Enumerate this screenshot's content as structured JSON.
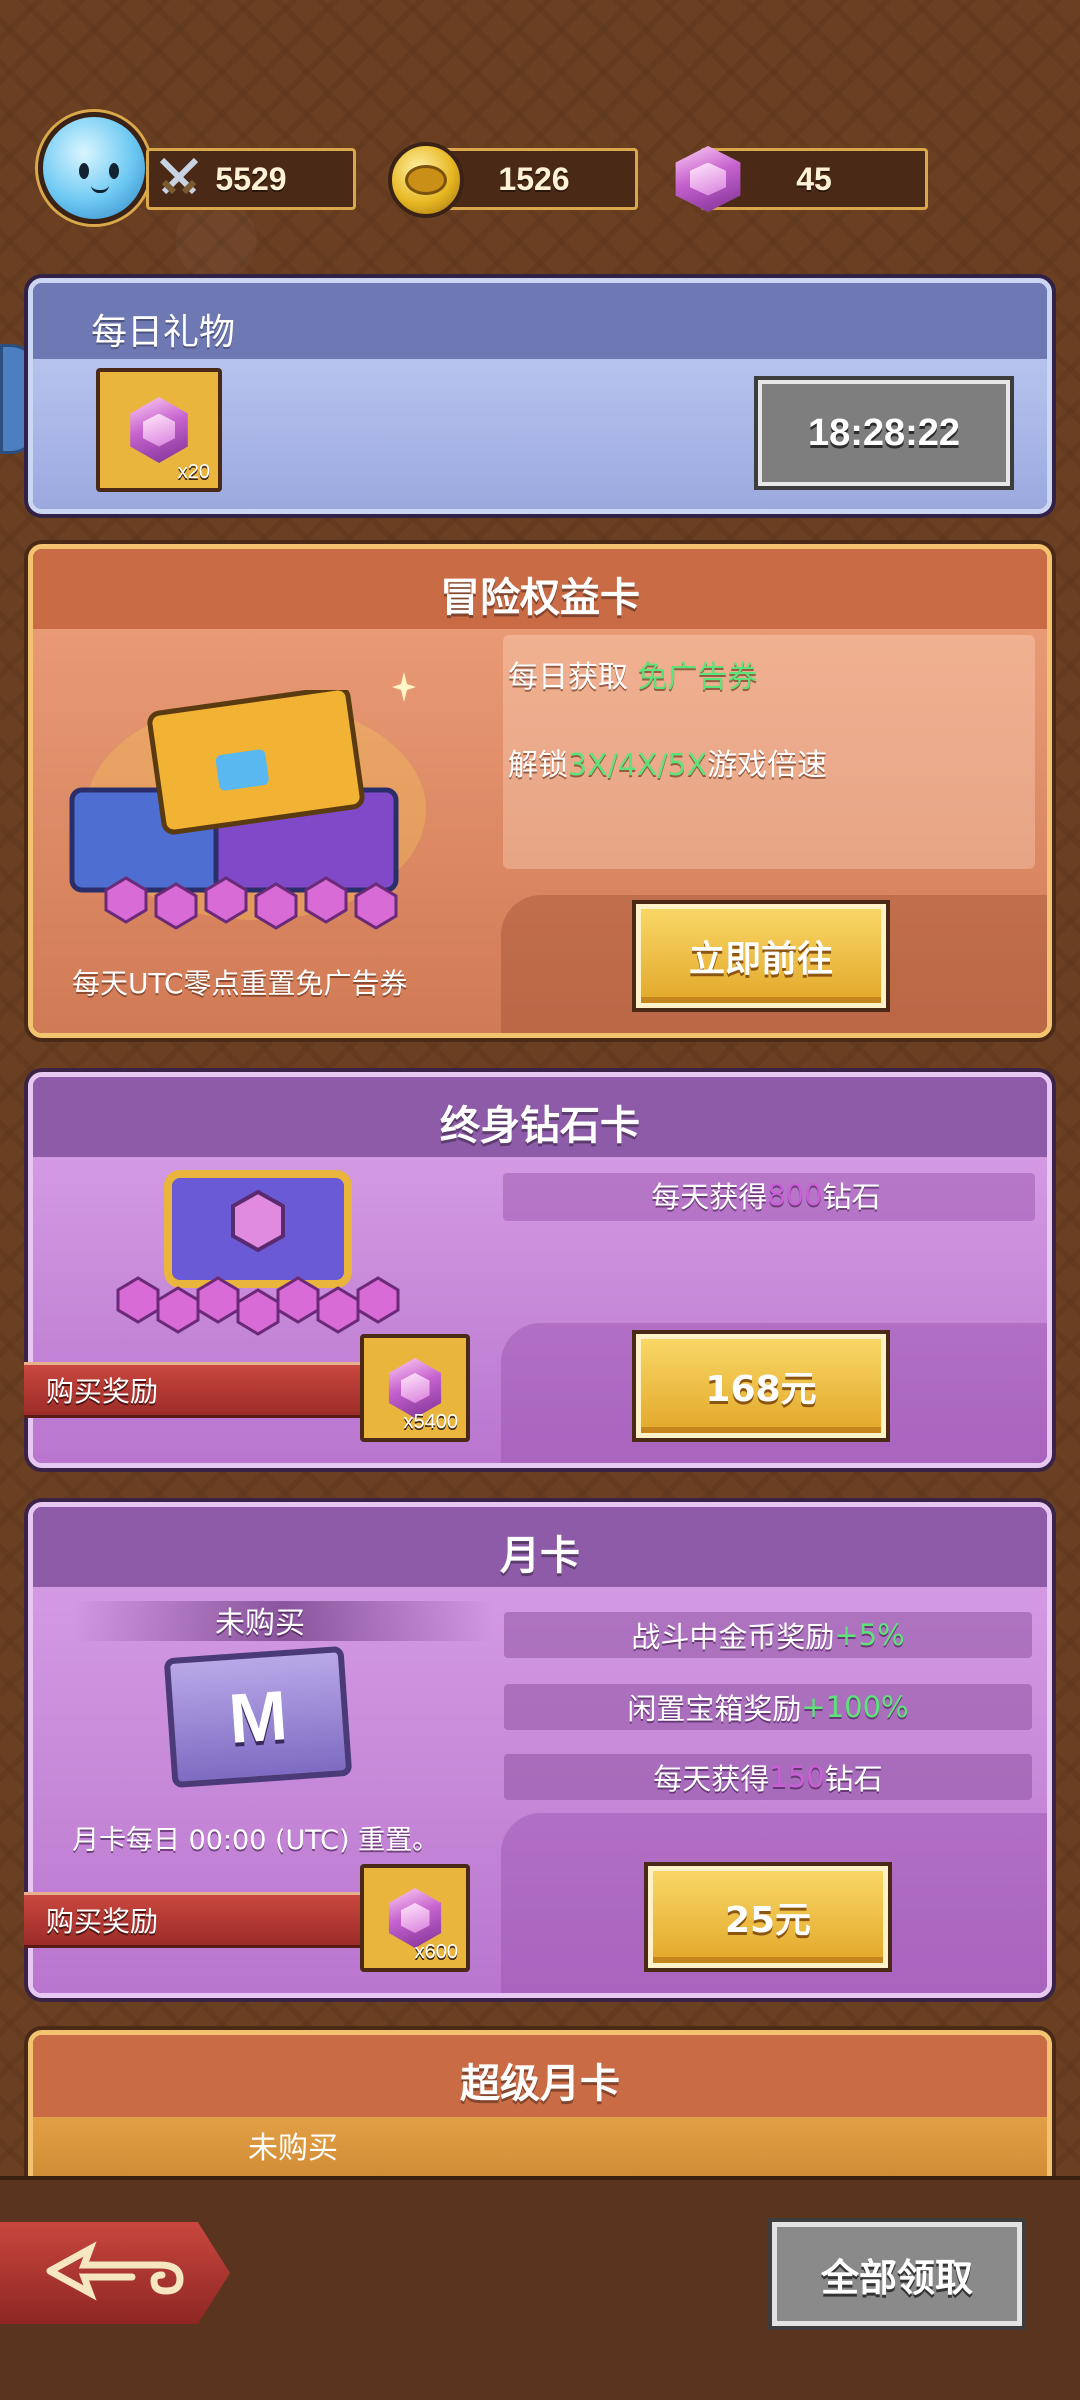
{
  "resources": {
    "power": "5529",
    "coins": "1526",
    "gems": "45"
  },
  "daily_gift": {
    "title": "每日礼物",
    "reward_qty": "x20",
    "timer": "18:28:22"
  },
  "adventure_card": {
    "title": "冒险权益卡",
    "benefit1_prefix": "每日获取 ",
    "benefit1_highlight": "免广告券",
    "benefit2_prefix": "解锁",
    "benefit2_highlight": "3X/4X/5X",
    "benefit2_suffix": "游戏倍速",
    "reset_note": "每天UTC零点重置免广告券",
    "button": "立即前往"
  },
  "lifetime_card": {
    "title": "终身钻石卡",
    "benefit_prefix": "每天获得 ",
    "benefit_value": "800",
    "benefit_suffix": " 钻石",
    "ribbon": "购买奖励",
    "reward_qty": "x5400",
    "price": "168元"
  },
  "monthly_card": {
    "title": "月卡",
    "status": "未购买",
    "card_letter": "M",
    "reset_note": "月卡每日 00:00 (UTC) 重置。",
    "row1_prefix": "战斗中金币奖励 ",
    "row1_value": "+5%",
    "row2_prefix": "闲置宝箱奖励 ",
    "row2_value": "+100%",
    "row3_prefix": "每天获得 ",
    "row3_value": "150",
    "row3_suffix": " 钻石",
    "ribbon": "购买奖励",
    "reward_qty": "x600",
    "price": "25元"
  },
  "super_monthly_card": {
    "title": "超级月卡",
    "status": "未购买"
  },
  "footer": {
    "claim_all": "全部领取"
  },
  "colors": {
    "highlight_green": "#5fe27a",
    "highlight_purple": "#c95fd6",
    "gold_button": "#f0c040"
  }
}
